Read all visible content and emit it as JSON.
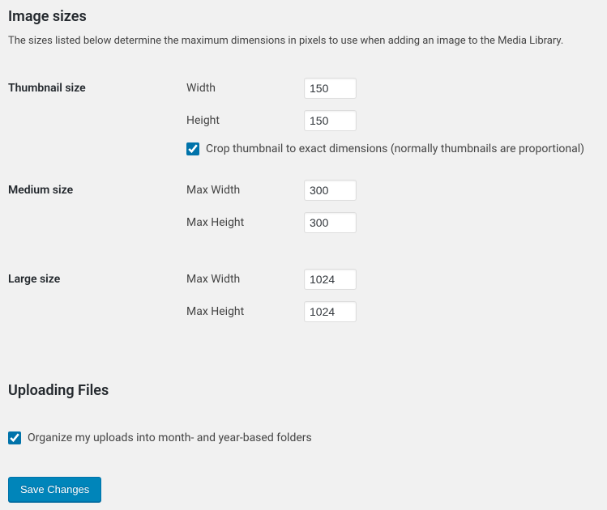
{
  "sections": {
    "image_sizes": {
      "title": "Image sizes",
      "description": "The sizes listed below determine the maximum dimensions in pixels to use when adding an image to the Media Library."
    },
    "uploading_files": {
      "title": "Uploading Files"
    }
  },
  "thumbnail": {
    "heading": "Thumbnail size",
    "width_label": "Width",
    "width_value": "150",
    "height_label": "Height",
    "height_value": "150",
    "crop_label": "Crop thumbnail to exact dimensions (normally thumbnails are proportional)",
    "crop_checked": true
  },
  "medium": {
    "heading": "Medium size",
    "max_width_label": "Max Width",
    "max_width_value": "300",
    "max_height_label": "Max Height",
    "max_height_value": "300"
  },
  "large": {
    "heading": "Large size",
    "max_width_label": "Max Width",
    "max_width_value": "1024",
    "max_height_label": "Max Height",
    "max_height_value": "1024"
  },
  "uploads": {
    "organize_label": "Organize my uploads into month- and year-based folders",
    "organize_checked": true
  },
  "buttons": {
    "save": "Save Changes"
  }
}
